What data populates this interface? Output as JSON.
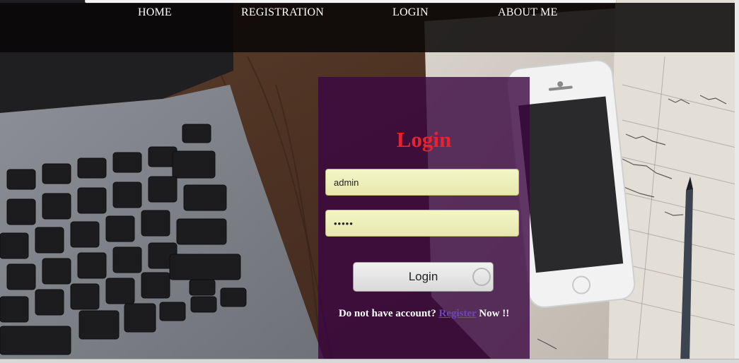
{
  "nav": {
    "home": "HOME",
    "registration": "REGISTRATION",
    "login": "LOGIN",
    "about": "ABOUT ME"
  },
  "login": {
    "title": "Login",
    "username_value": "admin",
    "password_value": "•••••",
    "button_label": "Login",
    "prompt_before": "Do not have account? ",
    "register_link": "Register",
    "prompt_after": " Now !!"
  },
  "colors": {
    "title": "#e8232d",
    "panel": "#3a0640",
    "link": "#6b48b8"
  }
}
